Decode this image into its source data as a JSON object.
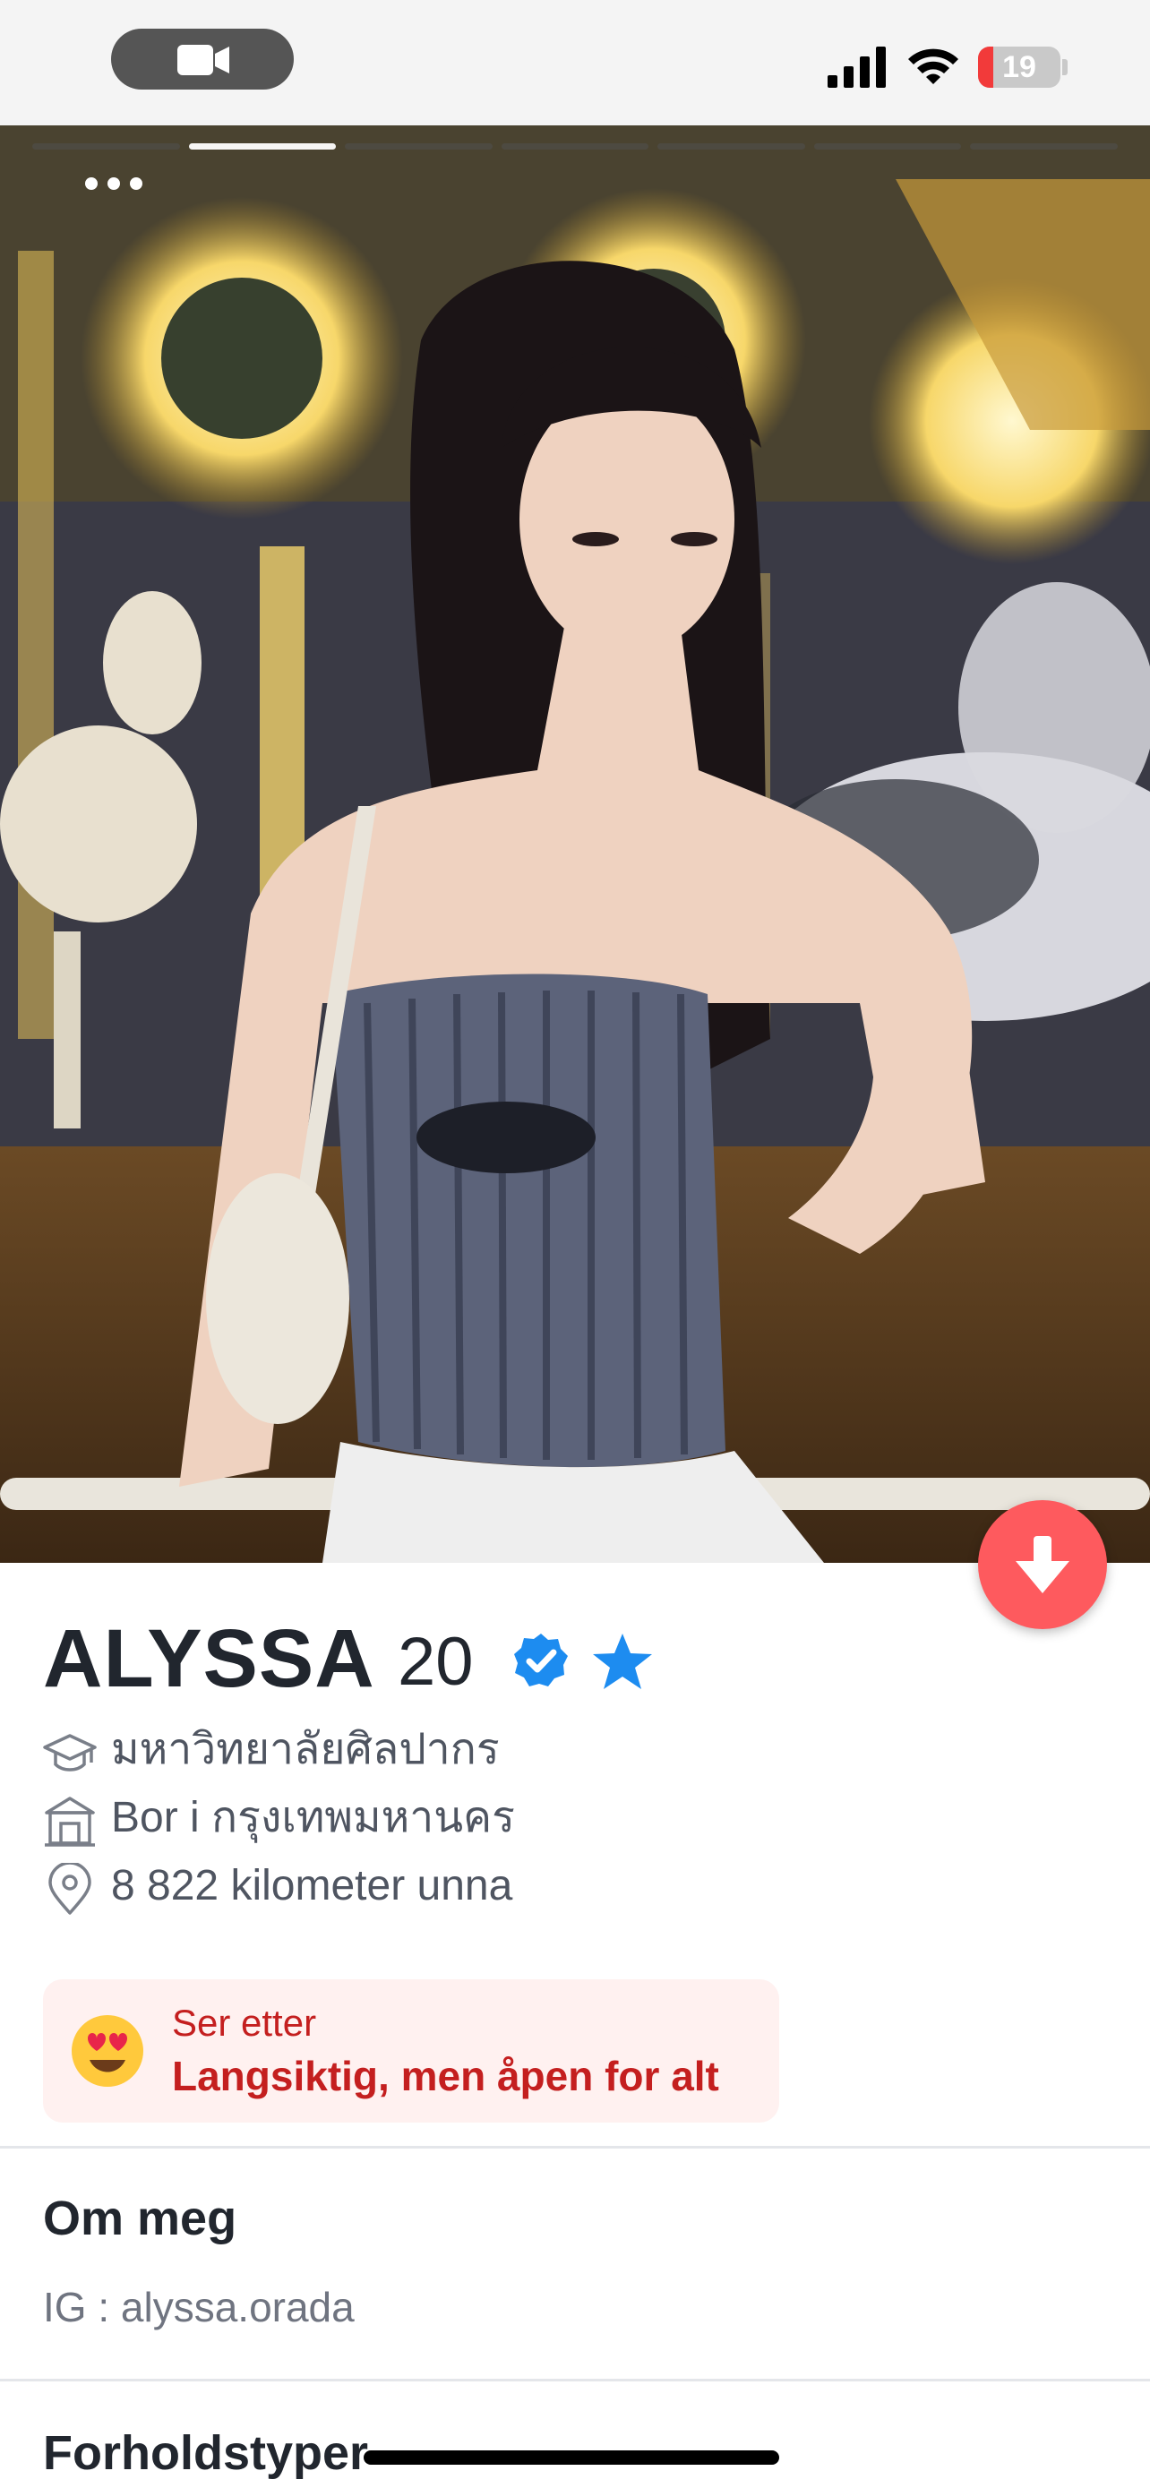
{
  "status_bar": {
    "battery_level": "19",
    "battery_fraction": 0.19,
    "icons": [
      "video-camera-icon",
      "cellular-signal-icon",
      "wifi-icon",
      "battery-icon"
    ]
  },
  "photo": {
    "story_segments": 7,
    "active_segment": 2,
    "icons": [
      "more-dots-icon",
      "arrow-down-icon"
    ]
  },
  "profile": {
    "name": "ALYSSA",
    "age": "20",
    "school": "มหาวิทยาลัยศิลปากร",
    "residence": "Bor i กรุงเทพมหานคร",
    "distance": "8 822 kilometer unna"
  },
  "looking_for": {
    "label": "Ser etter",
    "value": "Langsiktig, men åpen for alt"
  },
  "about": {
    "title": "Om meg",
    "text": "IG : alyssa.orada"
  },
  "relationship_types": {
    "title": "Forholdstyper"
  },
  "colors": {
    "accent": "#fe5a5e",
    "verified": "#1d8cf0",
    "looking_for_text": "#c41f1f",
    "looking_for_bg": "#fff1f0"
  }
}
